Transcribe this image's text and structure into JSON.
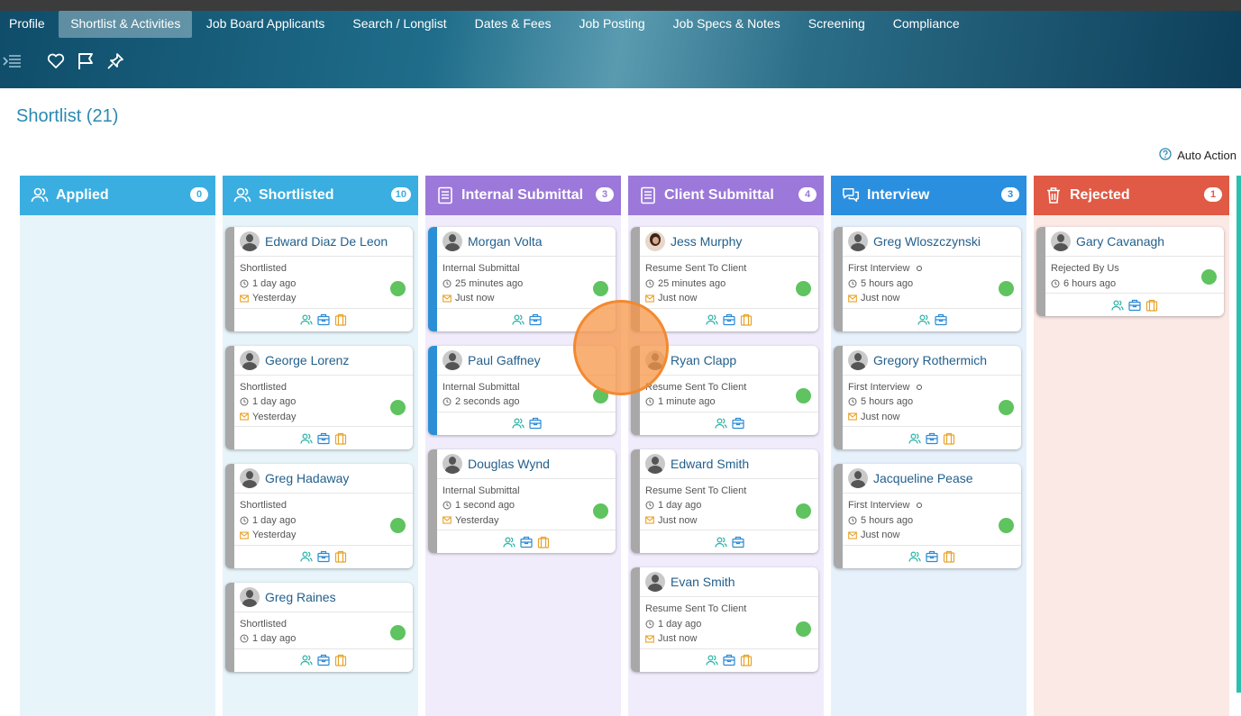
{
  "tabs": [
    "Profile",
    "Shortlist & Activities",
    "Job Board Applicants",
    "Search / Longlist",
    "Dates & Fees",
    "Job Posting",
    "Job Specs & Notes",
    "Screening",
    "Compliance"
  ],
  "active_tab": "Shortlist & Activities",
  "toolbar_icons": [
    "menu-indent-icon",
    "heart-icon",
    "flag-icon",
    "pin-icon"
  ],
  "page_title": "Shortlist (21)",
  "auto_action_label": "Auto Action",
  "colors": {
    "applied": "#3aaee0",
    "shortlisted": "#3aaee0",
    "internal": "#9b78d9",
    "client": "#9b78d9",
    "interview": "#2b8fe0",
    "rejected": "#e05a45",
    "green_status": "#5fc35f",
    "link": "#23608c"
  },
  "columns": [
    {
      "title": "Applied",
      "count": "0",
      "icon": "users-icon",
      "cards": []
    },
    {
      "title": "Shortlisted",
      "count": "10",
      "icon": "users-icon",
      "cards": [
        {
          "name": "Edward Diaz De Leon",
          "status": "Shortlisted",
          "time": "1 day ago",
          "mail": "Yesterday",
          "actions": 3
        },
        {
          "name": "George Lorenz",
          "status": "Shortlisted",
          "time": "1 day ago",
          "mail": "Yesterday",
          "actions": 3
        },
        {
          "name": "Greg Hadaway",
          "status": "Shortlisted",
          "time": "1 day ago",
          "mail": "Yesterday",
          "actions": 3
        },
        {
          "name": "Greg Raines",
          "status": "Shortlisted",
          "time": "1 day ago",
          "mail": "",
          "actions": 3
        }
      ]
    },
    {
      "title": "Internal Submittal",
      "count": "3",
      "icon": "document-icon",
      "cards": [
        {
          "name": "Morgan Volta",
          "status": "Internal Submittal",
          "time": "25 minutes ago",
          "mail": "Just now",
          "actions": 2,
          "blue": true
        },
        {
          "name": "Paul Gaffney",
          "status": "Internal Submittal",
          "time": "2 seconds ago",
          "mail": "",
          "actions": 2,
          "blue": true
        },
        {
          "name": "Douglas Wynd",
          "status": "Internal Submittal",
          "time": "1 second ago",
          "mail": "Yesterday",
          "actions": 3
        }
      ]
    },
    {
      "title": "Client Submittal",
      "count": "4",
      "icon": "document-icon",
      "cards": [
        {
          "name": "Jess Murphy",
          "status": "Resume Sent To Client",
          "time": "25 minutes ago",
          "mail": "Just now",
          "actions": 3,
          "photo": true
        },
        {
          "name": "Ryan Clapp",
          "status": "Resume Sent To Client",
          "time": "1 minute ago",
          "mail": "",
          "actions": 2
        },
        {
          "name": "Edward Smith",
          "status": "Resume Sent To Client",
          "time": "1 day ago",
          "mail": "Just now",
          "actions": 2
        },
        {
          "name": "Evan Smith",
          "status": "Resume Sent To Client",
          "time": "1 day ago",
          "mail": "Just now",
          "actions": 3
        }
      ]
    },
    {
      "title": "Interview",
      "count": "3",
      "icon": "chat-icon",
      "cards": [
        {
          "name": "Greg Wloszczynski",
          "status": "First Interview",
          "time": "5 hours ago",
          "mail": "Just now",
          "actions": 2,
          "dot": true
        },
        {
          "name": "Gregory Rothermich",
          "status": "First Interview",
          "time": "5 hours ago",
          "mail": "Just now",
          "actions": 3,
          "dot": true
        },
        {
          "name": "Jacqueline Pease",
          "status": "First Interview",
          "time": "5 hours ago",
          "mail": "Just now",
          "actions": 3,
          "dot": true
        }
      ]
    },
    {
      "title": "Rejected",
      "count": "1",
      "icon": "trash-icon",
      "cards": [
        {
          "name": "Gary Cavanagh",
          "status": "Rejected By Us",
          "time": "6 hours ago",
          "mail": "",
          "actions": 3
        }
      ]
    }
  ]
}
